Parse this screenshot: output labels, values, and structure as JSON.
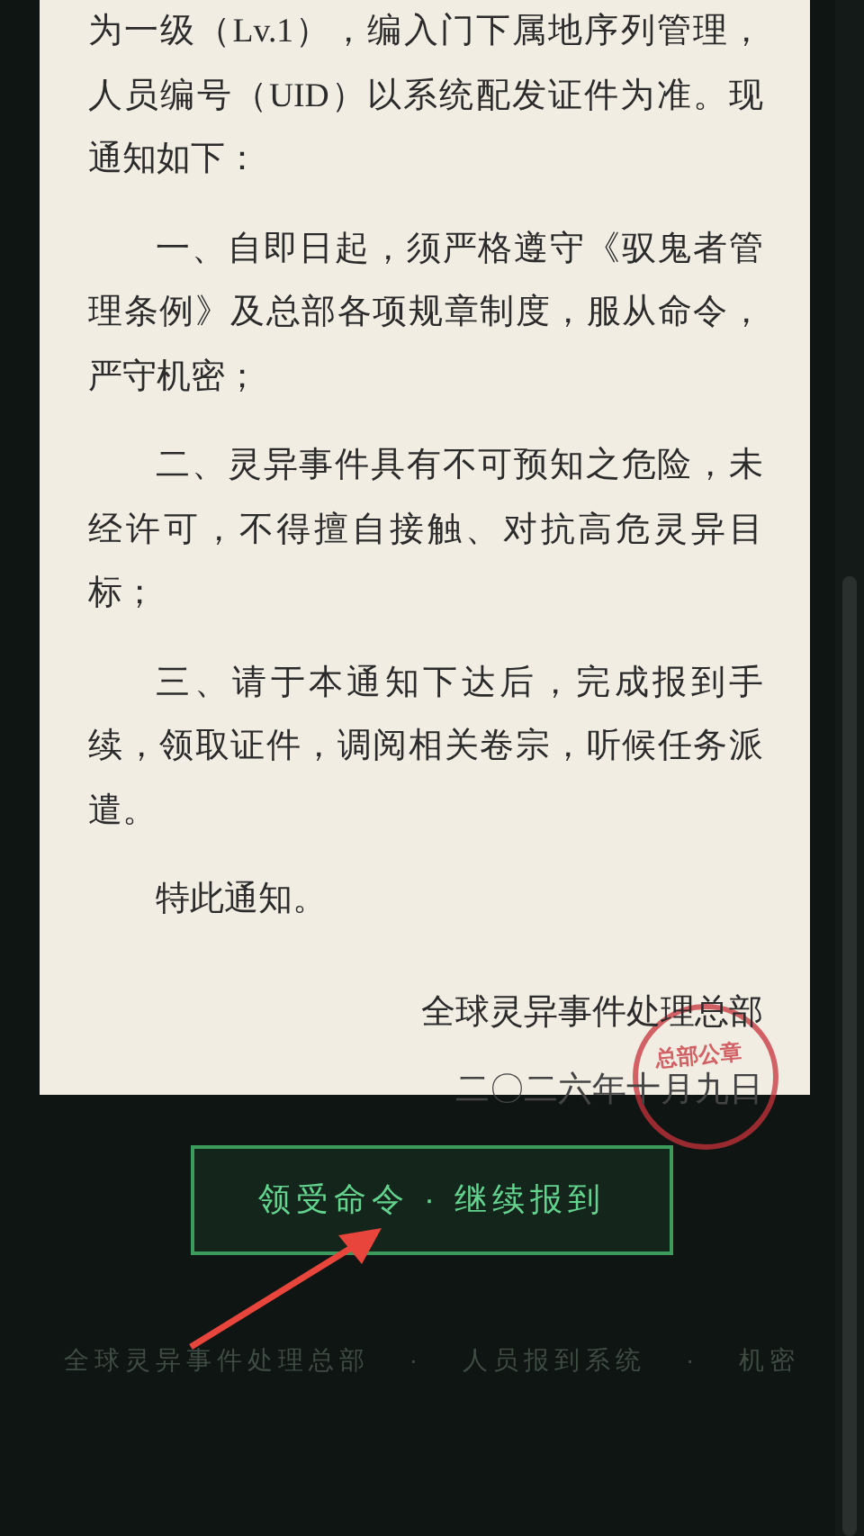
{
  "notice": {
    "paragraphs": [
      {
        "text": "为一级（Lv.1），编入门下属地序列管理，人员编号（UID）以系统配发证件为准。现通知如下：",
        "indent": false
      },
      {
        "text": "一、自即日起，须严格遵守《驭鬼者管理条例》及总部各项规章制度，服从命令，严守机密；",
        "indent": true
      },
      {
        "text": "二、灵异事件具有不可预知之危险，未经许可，不得擅自接触、对抗高危灵异目标；",
        "indent": true
      },
      {
        "text": "三、请于本通知下达后，完成报到手续，领取证件，调阅相关卷宗，听候任务派遣。",
        "indent": true
      },
      {
        "text": "特此通知。",
        "indent": true
      }
    ],
    "signature": "全球灵异事件处理总部",
    "date": "二〇二六年十月九日",
    "stamp": "总部公章"
  },
  "action_button": {
    "label": "领受命令 · 继续报到"
  },
  "footer": [
    "全球灵异事件处理总部",
    "·",
    "人员报到系统",
    "·",
    "机密"
  ]
}
